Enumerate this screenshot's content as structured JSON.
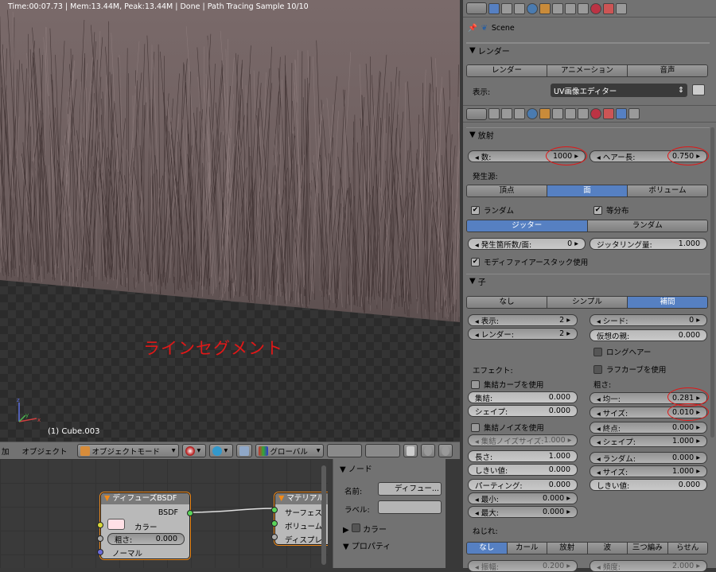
{
  "viewport": {
    "status": "Time:00:07.73 | Mem:13.44M, Peak:13.44M | Done | Path Tracing Sample 10/10",
    "overlay": "ラインセグメント",
    "object_name": "(1) Cube.003"
  },
  "header3d": {
    "menu_add": "加",
    "menu_object": "オブジェクト",
    "mode": "オブジェクトモード",
    "orientation": "グローバル"
  },
  "nodes": {
    "diffuse": {
      "title": "ディフューズBSDF",
      "out": "BSDF",
      "color": "カラー",
      "rough_label": "粗さ:",
      "rough_value": "0.000",
      "normal": "ノーマル"
    },
    "material": {
      "title": "マテリアル",
      "surface": "サーフェス",
      "volume": "ボリューム",
      "displacement": "ディスプレ"
    }
  },
  "npanel": {
    "node_header": "ノード",
    "name_label": "名前:",
    "name_value": "ディフュー...",
    "label_label": "ラベル:",
    "color_header": "カラー",
    "props_header": "プロパティ"
  },
  "scene": {
    "label": "Scene"
  },
  "render": {
    "header": "レンダー",
    "btn_render": "レンダー",
    "btn_anim": "アニメーション",
    "btn_audio": "音声",
    "display_label": "表示:",
    "display_value": "UV画像エディター"
  },
  "emission": {
    "header": "放射",
    "count_label": "数:",
    "count_value": "1000",
    "hair_len_label": "ヘアー長:",
    "hair_len_value": "0.750",
    "source_label": "発生源:",
    "source_options": [
      "頂点",
      "面",
      "ボリューム"
    ],
    "random": "ランダム",
    "even": "等分布",
    "dist_options": [
      "ジッター",
      "ランダム"
    ],
    "per_face_label": "発生箇所数/面:",
    "per_face_value": "0",
    "jitter_label": "ジッタリング量:",
    "jitter_value": "1.000",
    "modifier_stack": "モディファイアースタック使用"
  },
  "children": {
    "header": "子",
    "options": [
      "なし",
      "シンプル",
      "補間"
    ],
    "display_label": "表示:",
    "display_value": "2",
    "render_label": "レンダー:",
    "render_value": "2",
    "seed_label": "シード:",
    "seed_value": "0",
    "virtual_parent_label": "仮想の親:",
    "virtual_parent_value": "0.000",
    "long_hair": "ロングヘアー",
    "effects_label": "エフェクト:",
    "rough_curve": "ラフカーブを使用",
    "clump_curve": "集結カーブを使用",
    "clump_label": "集結:",
    "clump_value": "0.000",
    "shape_label": "シェイプ:",
    "shape_value": "0.000",
    "clump_noise": "集結ノイズを使用",
    "clump_noise_size_label": "集結ノイズサイズ:",
    "clump_noise_size_value": "1.000",
    "length_label": "長さ:",
    "length_value": "1.000",
    "threshold_label": "しきい値:",
    "threshold_value": "0.000",
    "parting_label": "パーティング:",
    "parting_value": "0.000",
    "min_label": "最小:",
    "min_value": "0.000",
    "max_label": "最大:",
    "max_value": "0.000",
    "roughness_label": "粗さ:",
    "uniform_label": "均一:",
    "uniform_value": "0.281",
    "size_label": "サイズ:",
    "size_value": "0.010",
    "end_label": "終点:",
    "end_value": "0.000",
    "rshape_label": "シェイプ:",
    "rshape_value": "1.000",
    "random_label": "ランダム:",
    "random_value": "0.000",
    "rsize_label": "サイズ:",
    "rsize_value": "1.000",
    "rthreshold_label": "しきい値:",
    "rthreshold_value": "0.000",
    "kink_label": "ねじれ:",
    "kink_options": [
      "なし",
      "カール",
      "放射",
      "波",
      "三つ編み",
      "らせん"
    ],
    "amp_label": "振幅:",
    "amp_value": "0.200",
    "freq_label": "頻度:",
    "freq_value": "2.000"
  },
  "colors": {
    "accent": "#5680c2",
    "annotation": "#e01818",
    "node_outline": "#f08a1a"
  }
}
